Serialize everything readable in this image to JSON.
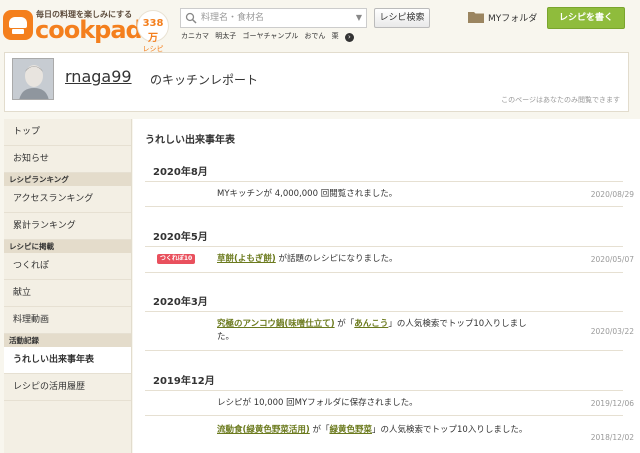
{
  "header": {
    "logo_tagline": "毎日の料理を楽しみにする",
    "logo_text": "cookpad",
    "logo_badge_number": "338万",
    "logo_badge_unit": "レシピ",
    "search_placeholder": "料理名・食材名",
    "search_button": "レシピ検索",
    "keywords": [
      "カニカマ",
      "明太子",
      "ゴーヤチャンプル",
      "おでん",
      "栗"
    ],
    "myfolder_label": "MYフォルダ",
    "post_button": "レシピを書く",
    "accent_color": "#f47f1d",
    "post_color": "#8fbc3c"
  },
  "profile": {
    "username": "rnaga99",
    "suffix": "のキッチンレポート",
    "visibility_note": "このページはあなたのみ閲覧できます"
  },
  "sidebar": {
    "top": "トップ",
    "news": "お知らせ",
    "ranking_head": "レシピランキング",
    "access_ranking": "アクセスランキング",
    "total_ranking": "累計ランキング",
    "listing_head": "レシピに掲載",
    "tsukurepo": "つくれぽ",
    "kondate": "献立",
    "video": "料理動画",
    "activity_head": "活動記録",
    "timeline": "うれしい出来事年表",
    "usage_history": "レシピの活用履歴"
  },
  "main": {
    "title": "うれしい出来事年表",
    "years": [
      "2020年8月",
      "2020年5月",
      "2020年3月",
      "2019年12月"
    ],
    "events": {
      "e1": {
        "text": "MYキッチンが 4,000,000 回閲覧されました。",
        "date": "2020/08/29"
      },
      "e2": {
        "badge": "つくれぽ10",
        "link": "草餅(よもぎ餅)",
        "text": " が話題のレシピになりました。",
        "date": "2020/05/07"
      },
      "e3": {
        "link": "究極のアンコウ鍋(味噌仕立て)",
        "mid1": " が「",
        "link2": "あんこう",
        "mid2": "」の人気検索でトップ10入りしました。",
        "date": "2020/03/22"
      },
      "e4": {
        "text": "レシピが 10,000 回MYフォルダに保存されました。",
        "date": "2019/12/06"
      },
      "e5": {
        "link": "流動食(緑黄色野菜活用)",
        "mid1": " が「",
        "link2": "緑黄色野菜",
        "mid2": "」の人気検索でトップ10入りしました。",
        "date": "2018/12/02"
      }
    }
  }
}
